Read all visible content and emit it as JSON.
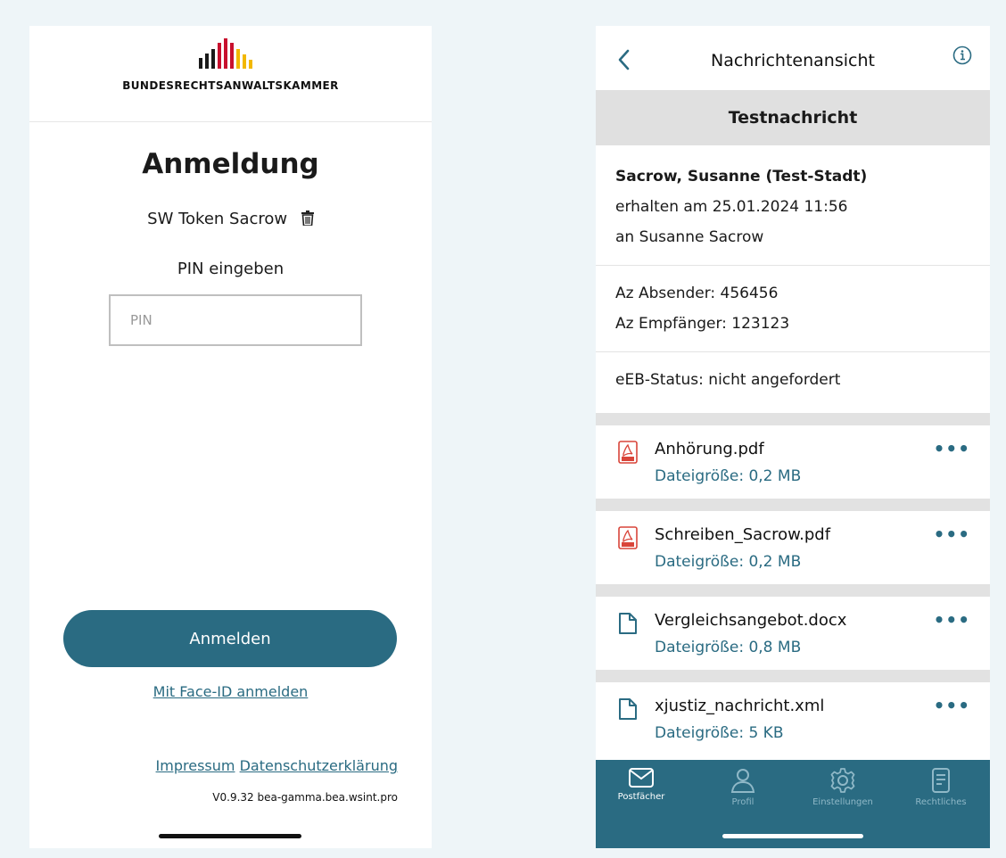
{
  "login_screen": {
    "brand_name": "BUNDESRECHTSANWALTSKAMMER",
    "title": "Anmeldung",
    "token_name": "SW Token Sacrow",
    "pin_label": "PIN eingeben",
    "pin_placeholder": "PIN",
    "pin_value": "",
    "login_button": "Anmelden",
    "faceid_link": "Mit Face-ID anmelden",
    "footer": {
      "impressum": "Impressum",
      "datenschutz": "Datenschutzerklärung",
      "version": "V0.9.32 bea-gamma.bea.wsint.pro"
    },
    "logo_colors": [
      "#1a1a1a",
      "#c8102e",
      "#f2b800"
    ]
  },
  "message_screen": {
    "nav_title": "Nachrichtenansicht",
    "subject": "Testnachricht",
    "sender": "Sacrow, Susanne (Test-Stadt)",
    "received": "erhalten am 25.01.2024 11:56",
    "recipient": "an Susanne Sacrow",
    "az_sender": "Az Absender: 456456",
    "az_recipient": "Az Empfänger: 123123",
    "eeb_status": "eEB-Status: nicht angefordert",
    "attachments": [
      {
        "name": "Anhörung.pdf",
        "size": "Dateigröße: 0,2 MB",
        "icon": "pdf-icon"
      },
      {
        "name": "Schreiben_Sacrow.pdf",
        "size": "Dateigröße: 0,2 MB",
        "icon": "pdf-icon"
      },
      {
        "name": "Vergleichsangebot.docx",
        "size": "Dateigröße: 0,8 MB",
        "icon": "document-icon"
      },
      {
        "name": "xjustiz_nachricht.xml",
        "size": "Dateigröße: 5 KB",
        "icon": "document-icon"
      }
    ],
    "more_label": "•••",
    "tabs": [
      {
        "label": "Postfächer",
        "icon": "mail-icon",
        "active": true
      },
      {
        "label": "Profil",
        "icon": "person-icon",
        "active": false
      },
      {
        "label": "Einstellungen",
        "icon": "gear-icon",
        "active": false
      },
      {
        "label": "Rechtliches",
        "icon": "legal-document-icon",
        "active": false
      }
    ],
    "accent_color": "#2a6b82"
  }
}
